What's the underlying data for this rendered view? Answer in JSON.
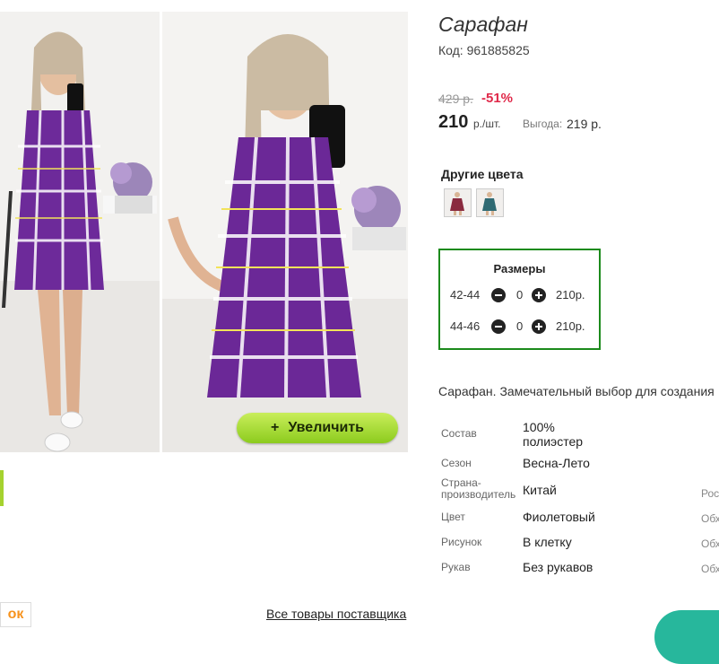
{
  "product": {
    "title": "Сарафан",
    "code": "Код: 961885825",
    "old_price": "429 р.",
    "discount": "-51%",
    "price": "210",
    "unit": "р./шт.",
    "savings_label": "Выгода:",
    "savings_value": "219 р."
  },
  "gallery": {
    "zoom_label": "Увеличить",
    "zoom_icon": "+"
  },
  "other_colors": {
    "title": "Другие цвета"
  },
  "sizes": {
    "title": "Размеры",
    "rows": [
      {
        "size": "42-44",
        "qty": "0",
        "price": "210р."
      },
      {
        "size": "44-46",
        "qty": "0",
        "price": "210р."
      }
    ]
  },
  "description": "Сарафан. Замечательный выбор для создания",
  "specs": [
    {
      "label": "Состав",
      "value": "100% полиэстер",
      "extra": ""
    },
    {
      "label": "Сезон",
      "value": "Весна-Лето",
      "extra": ""
    },
    {
      "label": "Страна-производитель",
      "value": "Китай",
      "extra": "Рос"
    },
    {
      "label": "Цвет",
      "value": "Фиолетовый",
      "extra": "Обх"
    },
    {
      "label": "Рисунок",
      "value": "В клетку",
      "extra": "Обх"
    },
    {
      "label": "Рукав",
      "value": "Без рукавов",
      "extra": "Обх"
    }
  ],
  "footer": {
    "supplier_link": "Все товары поставщика",
    "social_icon": "ok-icon"
  }
}
